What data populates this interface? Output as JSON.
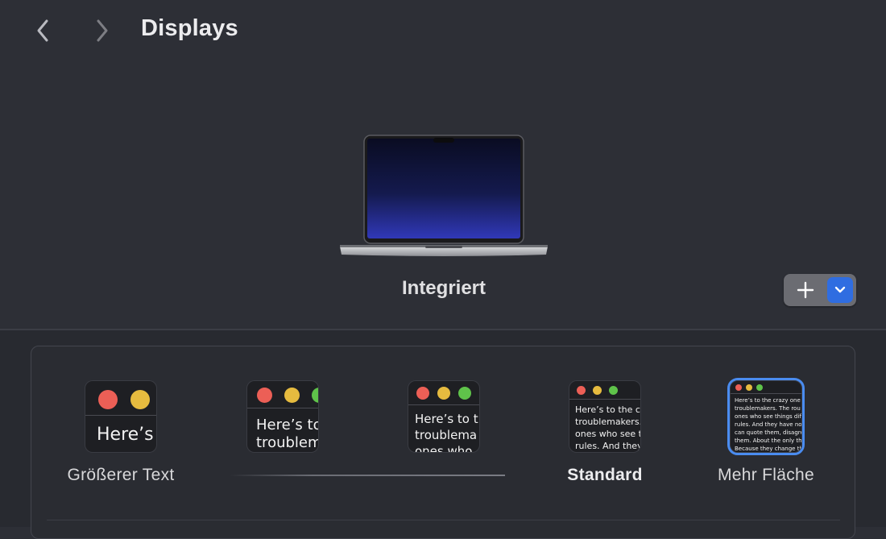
{
  "header": {
    "title": "Displays"
  },
  "display": {
    "name": "Integriert"
  },
  "resolution": {
    "options": [
      {
        "label": "Größerer Text",
        "sample": "Here’s"
      },
      {
        "label": "",
        "sample": "Here’s to\ntroublem"
      },
      {
        "label": "",
        "sample": "Here’s to t\ntroublema\nones who"
      },
      {
        "label": "Standard",
        "sample": "Here’s to the cr\ntroublemakers.\nones who see t\nrules. And they"
      },
      {
        "label": "Mehr Fläche",
        "sample": "Here’s to the crazy one\ntroublemakers. The rou\nones who see things diff\nrules. And they have no\ncan quote them, disagre\nthem. About the only th\nBecause they change th"
      }
    ]
  },
  "colors": {
    "red": "#ec5f56",
    "yellow": "#e6bb3f",
    "green": "#5fc34a",
    "accent": "#2f6de1",
    "selection": "#4a8cf0"
  },
  "icons": {
    "back": "chevron-left-icon",
    "forward": "chevron-right-icon",
    "add": "plus-icon",
    "menu": "chevron-down-icon"
  }
}
